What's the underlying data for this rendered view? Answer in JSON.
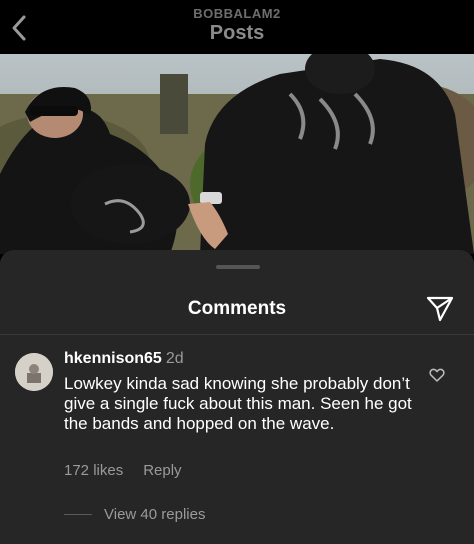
{
  "header": {
    "username": "BOBBALAM2",
    "title": "Posts"
  },
  "icons": {
    "back": "chevron-left-icon",
    "send": "paper-plane-icon",
    "like": "heart-outline-icon"
  },
  "sheet": {
    "title": "Comments"
  },
  "comment": {
    "username": "hkennison65",
    "time": "2d",
    "text": "Lowkey kinda sad knowing she probably don’t give a single fuck about this man. Seen he got the bands and hopped on the wave.",
    "likes": "172 likes",
    "reply_label": "Reply",
    "view_replies": "View 40 replies"
  },
  "colors": {
    "sheet_bg": "#262626",
    "secondary_text": "#9a9a9a"
  }
}
